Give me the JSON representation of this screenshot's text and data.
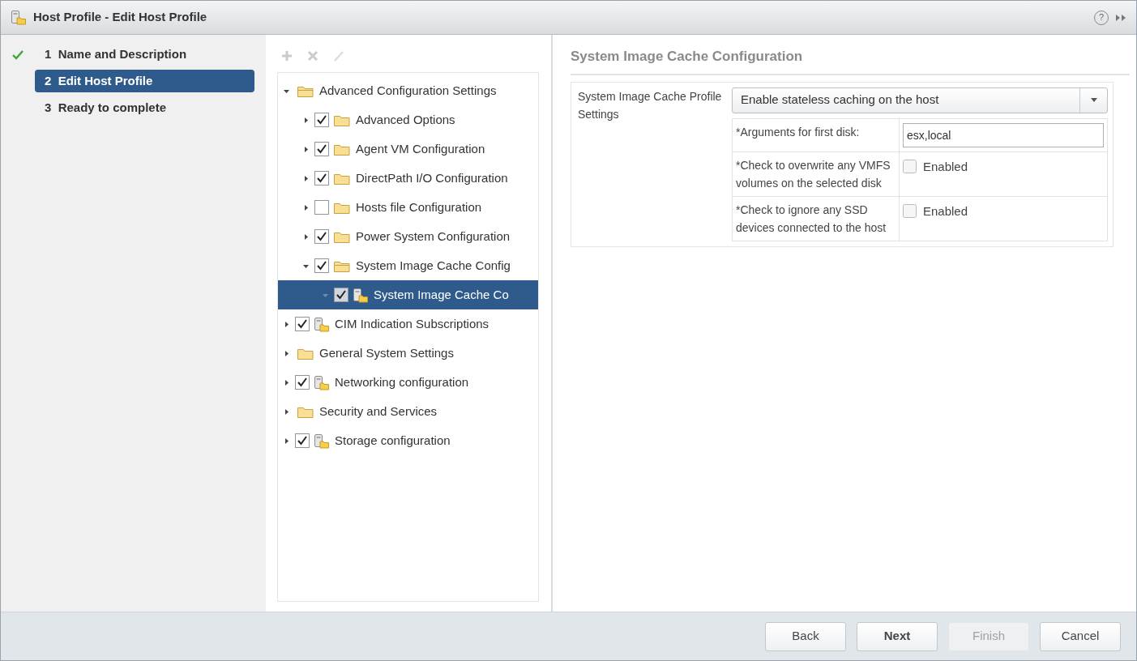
{
  "window": {
    "title": "Host Profile - Edit Host Profile",
    "help_button": "?"
  },
  "steps": [
    {
      "number": "1",
      "label": "Name and Description",
      "completed": true,
      "selected": false
    },
    {
      "number": "2",
      "label": "Edit Host Profile",
      "completed": false,
      "selected": true
    },
    {
      "number": "3",
      "label": "Ready to complete",
      "completed": false,
      "selected": false
    }
  ],
  "toolbar": [
    {
      "kind": "add",
      "disabled": true
    },
    {
      "kind": "delete",
      "disabled": true
    },
    {
      "kind": "edit",
      "disabled": true
    }
  ],
  "tree": [
    {
      "label": "Advanced Configuration Settings",
      "kind": "folder",
      "expanded": true,
      "selected": false,
      "children": [
        {
          "label": "Advanced Options",
          "kind": "checkable-folder",
          "checked": true,
          "expanded": false,
          "selected": false
        },
        {
          "label": "Agent VM Configuration",
          "kind": "checkable-folder",
          "checked": true,
          "expanded": false,
          "selected": false
        },
        {
          "label": "DirectPath I/O Configuration",
          "kind": "checkable-folder",
          "checked": true,
          "expanded": false,
          "selected": false
        },
        {
          "label": "Hosts file Configuration",
          "kind": "checkable-folder",
          "checked": false,
          "expanded": false,
          "selected": false
        },
        {
          "label": "Power System Configuration",
          "kind": "checkable-folder",
          "checked": true,
          "expanded": false,
          "selected": false
        },
        {
          "label": "System Image Cache Config",
          "kind": "checkable-folder",
          "checked": true,
          "expanded": true,
          "selected": false,
          "children": [
            {
              "label": "System Image Cache Co",
              "kind": "checkable-profile",
              "checked": true,
              "expanded": true,
              "selected": true
            }
          ]
        }
      ]
    },
    {
      "label": "CIM Indication Subscriptions",
      "kind": "checkable-profile",
      "checked": true,
      "expanded": false,
      "selected": false
    },
    {
      "label": "General System Settings",
      "kind": "folder",
      "expanded": false,
      "selected": false
    },
    {
      "label": "Networking configuration",
      "kind": "checkable-profile",
      "checked": true,
      "expanded": false,
      "selected": false
    },
    {
      "label": "Security and Services",
      "kind": "folder",
      "expanded": false,
      "selected": false
    },
    {
      "label": "Storage configuration",
      "kind": "checkable-profile",
      "checked": true,
      "expanded": false,
      "selected": false
    }
  ],
  "details": {
    "heading": "System Image Cache Configuration",
    "setting_label": "System Image Cache Profile Settings",
    "dropdown_value": "Enable stateless caching on the host",
    "rows": [
      {
        "kind": "text",
        "label": "*Arguments for first disk:",
        "value": "esx,local"
      },
      {
        "kind": "checkbox",
        "label": "*Check to overwrite any VMFS volumes on the selected disk",
        "option": "Enabled",
        "checked": false
      },
      {
        "kind": "checkbox",
        "label": "*Check to ignore any SSD devices connected to the host",
        "option": "Enabled",
        "checked": false
      }
    ]
  },
  "buttons": [
    {
      "label": "Back",
      "emphasized": false,
      "disabled": false
    },
    {
      "label": "Next",
      "emphasized": true,
      "disabled": false
    },
    {
      "label": "Finish",
      "emphasized": false,
      "disabled": true
    },
    {
      "label": "Cancel",
      "emphasized": false,
      "disabled": false
    }
  ]
}
